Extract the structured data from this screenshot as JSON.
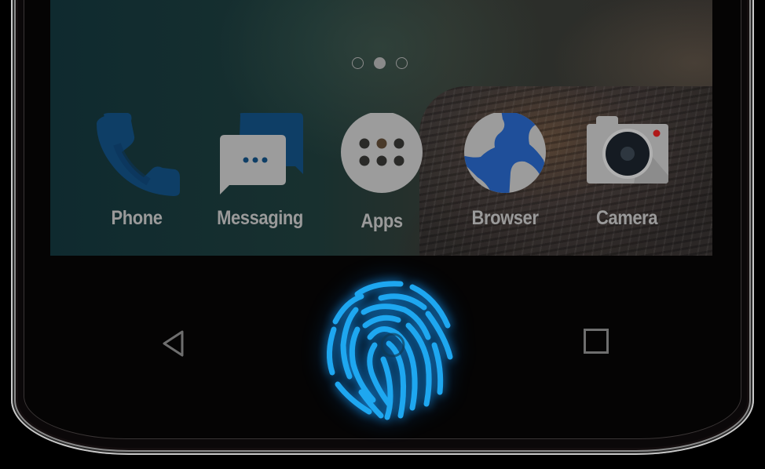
{
  "home_screen": {
    "page_indicator": {
      "total": 3,
      "active_index": 1
    },
    "dock": [
      {
        "id": "phone",
        "label": "Phone",
        "icon": "phone-icon"
      },
      {
        "id": "messaging",
        "label": "Messaging",
        "icon": "messaging-icon"
      },
      {
        "id": "apps",
        "label": "Apps",
        "icon": "apps-grid-icon"
      },
      {
        "id": "browser",
        "label": "Browser",
        "icon": "globe-icon"
      },
      {
        "id": "camera",
        "label": "Camera",
        "icon": "camera-icon"
      }
    ]
  },
  "navigation_bar": {
    "back": {
      "icon": "back-triangle-icon"
    },
    "home": {
      "icon": "fingerprint-icon"
    },
    "recents": {
      "icon": "recents-square-icon"
    }
  },
  "colors": {
    "fingerprint": "#1ea7f0",
    "icon_blue": "#0e3e66",
    "browser_blue": "#1f4f9a",
    "icon_gray": "#9c9c9c",
    "label_gray": "#9a9a9a",
    "camera_dot": "#b01818"
  }
}
